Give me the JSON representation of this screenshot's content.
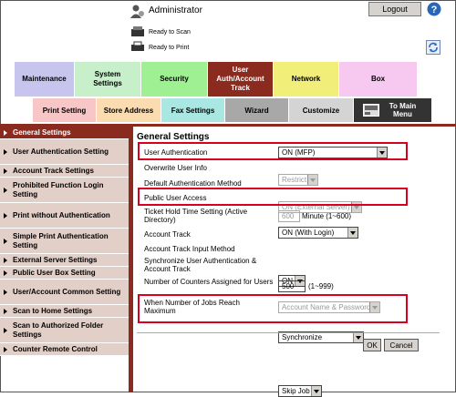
{
  "header": {
    "admin_label": "Administrator",
    "logout_label": "Logout",
    "scan_status": "Ready to Scan",
    "print_status": "Ready to Print"
  },
  "tabs": [
    {
      "label": "Maintenance",
      "color": "#c7c5ee"
    },
    {
      "label": "System Settings",
      "color": "#c7f0ca"
    },
    {
      "label": "Security",
      "color": "#9ff092"
    },
    {
      "label": "User Auth/Account Track",
      "color": "#8b2a1f"
    },
    {
      "label": "Network",
      "color": "#f2ee7a"
    },
    {
      "label": "Box",
      "color": "#f7c8f0"
    }
  ],
  "subtabs": [
    {
      "label": "Print Setting",
      "color": "#f8c6c6"
    },
    {
      "label": "Store Address",
      "color": "#fbdcb1"
    },
    {
      "label": "Fax Settings",
      "color": "#a9e7e2"
    },
    {
      "label": "Wizard",
      "color": "#a8a8a8"
    },
    {
      "label": "Customize",
      "color": "#d4d4d4"
    },
    {
      "label": "To Main Menu",
      "color": "#333333"
    }
  ],
  "sidebar": {
    "items": [
      "General Settings",
      "User Authentication Setting",
      "Account Track Settings",
      "Prohibited Function Login Setting",
      "Print without Authentication",
      "Simple Print Authentication Setting",
      "External Server Settings",
      "Public User Box Setting",
      "User/Account Common Setting",
      "Scan to Home Settings",
      "Scan to Authorized Folder Settings",
      "Counter Remote Control"
    ],
    "active_color": "#8b2a1f",
    "item_color": "#e2cfc8"
  },
  "content": {
    "section_title": "General Settings",
    "user_auth": {
      "label": "User Authentication",
      "value": "ON (MFP)"
    },
    "overwrite": {
      "label": "Overwrite User Info",
      "value": "Restrict"
    },
    "default_auth": {
      "label": "Default Authentication Method",
      "value": "ON (External Server)"
    },
    "public_access": {
      "label": "Public User Access",
      "value": "ON (With Login)"
    },
    "ticket_hold": {
      "label": "Ticket Hold Time Setting (Active Directory)",
      "value": "600",
      "unit": "Minute (1~600)"
    },
    "account_track": {
      "label": "Account Track",
      "value": "ON"
    },
    "account_input": {
      "label": "Account Track Input Method",
      "value": "Account Name & Password"
    },
    "sync": {
      "label": "Synchronize User Authentication & Account Track",
      "value": "Synchronize"
    },
    "counters": {
      "label": "Number of Counters Assigned for Users",
      "value": "500",
      "unit": "(1~999)"
    },
    "jobs_max": {
      "label": "When Number of Jobs Reach Maximum",
      "value": "Skip Job"
    },
    "ok_label": "OK",
    "cancel_label": "Cancel",
    "highlight_color": "#d8001e"
  }
}
